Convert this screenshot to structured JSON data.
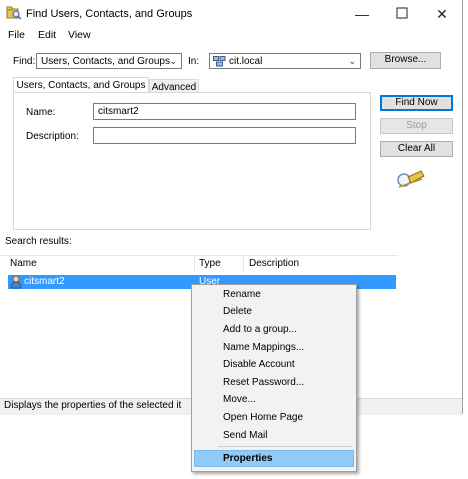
{
  "window": {
    "title": "Find Users, Contacts, and Groups"
  },
  "menu": [
    "File",
    "Edit",
    "View"
  ],
  "find_row": {
    "find_label": "Find:",
    "find_value": "Users, Contacts, and Groups",
    "in_label": "In:",
    "in_value": "cit.local",
    "browse_label": "Browse..."
  },
  "tabs": [
    "Users, Contacts, and Groups",
    "Advanced"
  ],
  "form": {
    "name_label": "Name:",
    "name_value": "citsmart2",
    "description_label": "Description:",
    "description_value": ""
  },
  "buttons": {
    "find_now": "Find Now",
    "stop": "Stop",
    "clear_all": "Clear All"
  },
  "results": {
    "label": "Search results:",
    "columns": [
      "Name",
      "Type",
      "Description"
    ],
    "rows": [
      {
        "name": "citsmart2",
        "type": "User",
        "description": ""
      }
    ]
  },
  "status": "Displays the properties of the selected it",
  "context_menu": {
    "items": [
      "Rename",
      "Delete",
      "Add to a group...",
      "Name Mappings...",
      "Disable Account",
      "Reset Password...",
      "Move...",
      "Open Home Page",
      "Send Mail"
    ],
    "highlighted": "Properties"
  },
  "icons": [
    "find-window-icon",
    "minimize-icon",
    "maximize-icon",
    "close-icon",
    "domain-icon",
    "flashlight-search-icon",
    "user-icon"
  ],
  "colors": {
    "selection": "#3399ff",
    "menu_highlight": "#91c9f7",
    "default_button_border": "#0078d7"
  }
}
